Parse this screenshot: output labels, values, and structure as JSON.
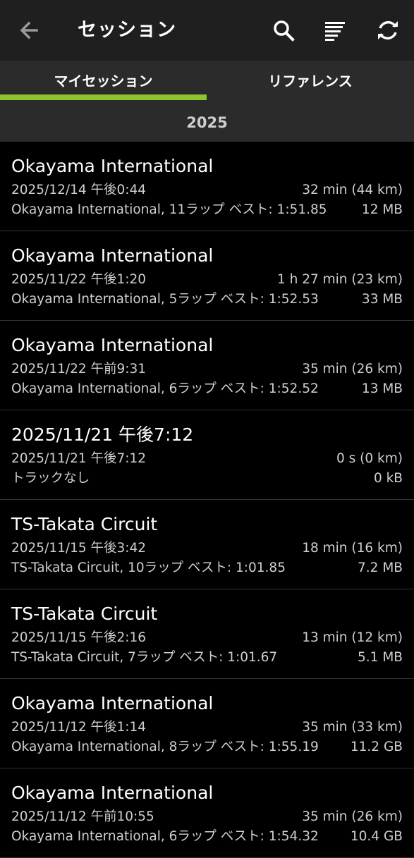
{
  "header": {
    "title": "セッション",
    "back_icon": "arrow-back-icon",
    "actions": [
      "search-icon",
      "sort-icon",
      "refresh-icon"
    ]
  },
  "tabs": [
    {
      "label": "マイセッション",
      "selected": true
    },
    {
      "label": "リファレンス",
      "selected": false
    }
  ],
  "accent_color": "#8dc62c",
  "year_header": "2025",
  "sessions": [
    {
      "name": "Okayama International",
      "datetime": "2025/12/14 午後0:44",
      "duration": "32 min (44 km)",
      "summary": "Okayama International, 11ラップ ベスト: 1:51.85",
      "size": "12 MB"
    },
    {
      "name": "Okayama International",
      "datetime": "2025/11/22 午後1:20",
      "duration": "1 h 27 min (23 km)",
      "summary": "Okayama International, 5ラップ ベスト: 1:52.53",
      "size": "33 MB"
    },
    {
      "name": "Okayama International",
      "datetime": "2025/11/22 午前9:31",
      "duration": "35 min (26 km)",
      "summary": "Okayama International, 6ラップ ベスト: 1:52.52",
      "size": "13 MB"
    },
    {
      "name": "2025/11/21 午後7:12",
      "datetime": "2025/11/21 午後7:12",
      "duration": "0 s (0 km)",
      "summary": "トラックなし",
      "size": "0 kB"
    },
    {
      "name": "TS-Takata Circuit",
      "datetime": "2025/11/15 午後3:42",
      "duration": "18 min (16 km)",
      "summary": "TS-Takata Circuit, 10ラップ ベスト: 1:01.85",
      "size": "7.2 MB"
    },
    {
      "name": "TS-Takata Circuit",
      "datetime": "2025/11/15 午後2:16",
      "duration": "13 min (12 km)",
      "summary": "TS-Takata Circuit, 7ラップ ベスト: 1:01.67",
      "size": "5.1 MB"
    },
    {
      "name": "Okayama International",
      "datetime": "2025/11/12 午後1:14",
      "duration": "35 min (33 km)",
      "summary": "Okayama International, 8ラップ ベスト: 1:55.19",
      "size": "11.2 GB"
    },
    {
      "name": "Okayama International",
      "datetime": "2025/11/12 午前10:55",
      "duration": "35 min (26 km)",
      "summary": "Okayama International, 6ラップ ベスト: 1:54.32",
      "size": "10.4 GB"
    }
  ]
}
